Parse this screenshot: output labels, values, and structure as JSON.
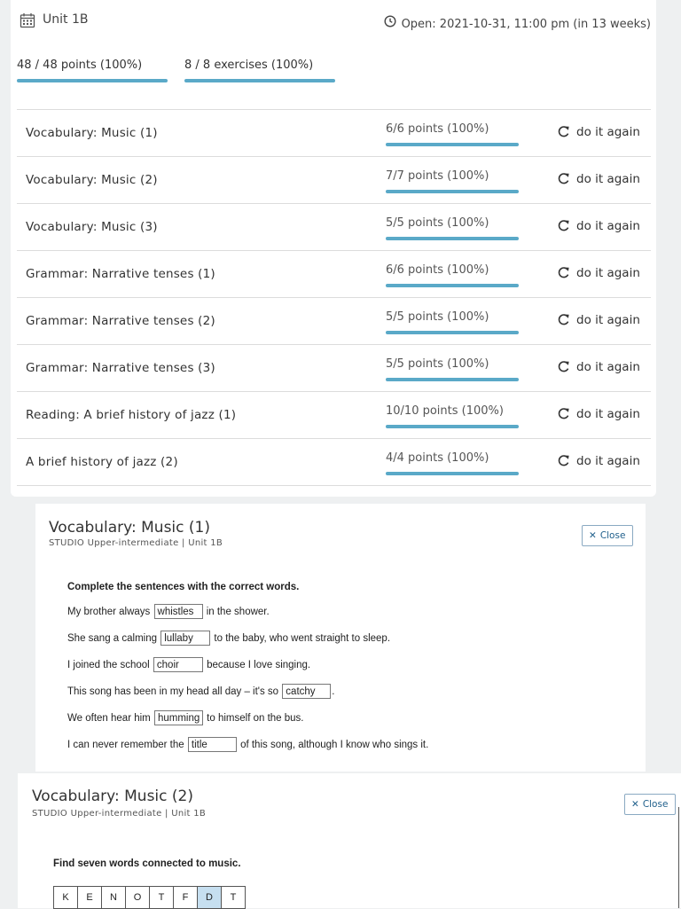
{
  "unit": {
    "title": "Unit 1B",
    "open_text": "Open: 2021-10-31, 11:00 pm (in 13 weeks)",
    "points_summary": "48 / 48 points (100%)",
    "exercises_summary": "8 / 8 exercises (100%)",
    "accent_color": "#5aa9c8"
  },
  "exercises": [
    {
      "name": "Vocabulary: Music (1)",
      "score": "6/6 points (100%)",
      "action": "do it again",
      "progress": 1.0
    },
    {
      "name": "Vocabulary: Music (2)",
      "score": "7/7 points (100%)",
      "action": "do it again",
      "progress": 1.0
    },
    {
      "name": "Vocabulary: Music (3)",
      "score": "5/5 points (100%)",
      "action": "do it again",
      "progress": 1.0
    },
    {
      "name": "Grammar: Narrative tenses (1)",
      "score": "6/6 points (100%)",
      "action": "do it again",
      "progress": 1.0
    },
    {
      "name": "Grammar: Narrative tenses (2)",
      "score": "5/5 points (100%)",
      "action": "do it again",
      "progress": 1.0
    },
    {
      "name": "Grammar: Narrative tenses (3)",
      "score": "5/5 points (100%)",
      "action": "do it again",
      "progress": 1.0
    },
    {
      "name": "Reading: A brief history of jazz (1)",
      "score": "10/10 points (100%)",
      "action": "do it again",
      "progress": 1.0
    },
    {
      "name": "A brief history of jazz (2)",
      "score": "4/4 points (100%)",
      "action": "do it again",
      "progress": 1.0
    }
  ],
  "panel1": {
    "title": "Vocabulary: Music (1)",
    "subtitle": "STUDIO Upper-intermediate | Unit 1B",
    "close_label": "Close",
    "instruction": "Complete the sentences with the correct words.",
    "sentences": [
      {
        "before": "My brother always",
        "answer": "whistles",
        "after": "in the shower."
      },
      {
        "before": "She sang a calming",
        "answer": "lullaby",
        "after": "to the baby, who went straight to sleep."
      },
      {
        "before": "I joined the school",
        "answer": "choir",
        "after": "because I love singing."
      },
      {
        "before": "This song has been in my head all day – it's so",
        "answer": "catchy",
        "after": "."
      },
      {
        "before": "We often hear him",
        "answer": "humming",
        "after": "to himself on the bus."
      },
      {
        "before": "I can never remember the",
        "answer": "title",
        "after": "of this song, although I know who sings it."
      }
    ]
  },
  "panel2": {
    "title": "Vocabulary: Music (2)",
    "subtitle": "STUDIO Upper-intermediate | Unit 1B",
    "close_label": "Close",
    "instruction": "Find seven words connected to music.",
    "grid_row": [
      "K",
      "E",
      "N",
      "O",
      "T",
      "F",
      "D",
      "T"
    ],
    "selected_index": 6,
    "selected_color": "#c6dff0"
  }
}
